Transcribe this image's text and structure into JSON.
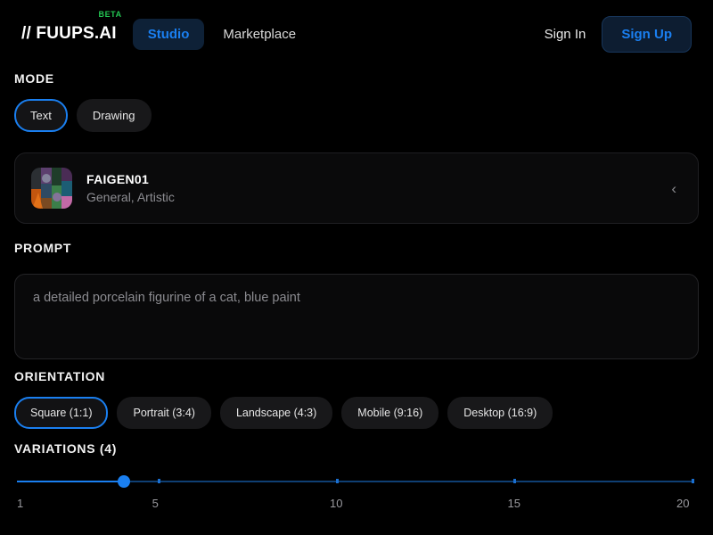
{
  "header": {
    "brand": "// FUUPS.AI",
    "beta_badge": "BETA",
    "nav": [
      {
        "label": "Studio",
        "active": true
      },
      {
        "label": "Marketplace",
        "active": false
      }
    ],
    "sign_in": "Sign In",
    "sign_up": "Sign Up",
    "accent_color": "#1a7ff0",
    "beta_color": "#23c552"
  },
  "mode": {
    "label": "MODE",
    "options": [
      {
        "label": "Text",
        "selected": true
      },
      {
        "label": "Drawing",
        "selected": false
      }
    ]
  },
  "model": {
    "name": "FAIGEN01",
    "tags": "General, Artistic",
    "thumbnail": "model-collage-thumbnail",
    "collapse_icon": "chevron-left-icon"
  },
  "prompt": {
    "label": "PROMPT",
    "placeholder": "a detailed porcelain figurine of a cat, blue paint",
    "value": ""
  },
  "orientation": {
    "label": "ORIENTATION",
    "options": [
      {
        "label": "Square (1:1)",
        "selected": true
      },
      {
        "label": "Portrait (3:4)",
        "selected": false
      },
      {
        "label": "Landscape (4:3)",
        "selected": false
      },
      {
        "label": "Mobile (9:16)",
        "selected": false
      },
      {
        "label": "Desktop (16:9)",
        "selected": false
      }
    ]
  },
  "variations": {
    "label": "VARIATIONS (4)",
    "value": 4,
    "min": 1,
    "max": 20,
    "ticks": [
      5,
      10,
      15,
      20
    ],
    "scale_labels": [
      "1",
      "5",
      "10",
      "15",
      "20"
    ]
  }
}
